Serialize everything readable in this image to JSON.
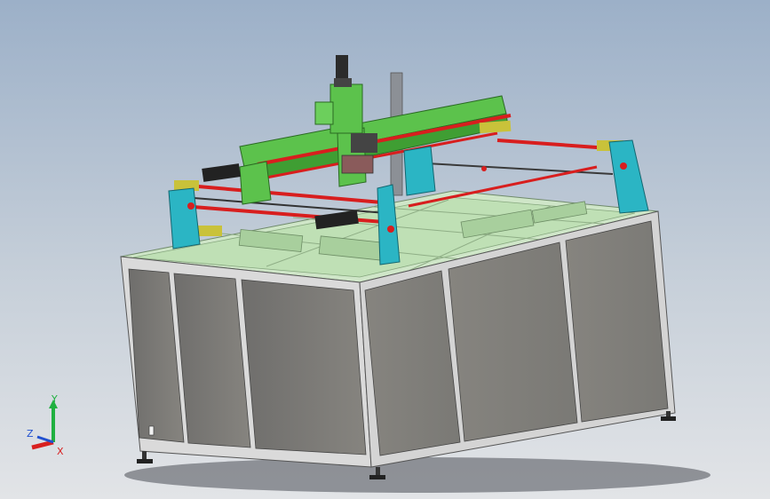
{
  "viewport": {
    "background_top": "#9cb0c8",
    "background_bottom": "#e2e4e7"
  },
  "colors": {
    "frame_green": "#5cc24c",
    "support_cyan": "#2bb5c4",
    "rod_red": "#d81e1e",
    "panel_gray": "#7b7a78",
    "table_top_green": "#cfe6c8"
  },
  "triad": {
    "x_label": "X",
    "y_label": "Y",
    "z_label": "Z",
    "x_color": "#d82020",
    "y_color": "#20b040",
    "z_color": "#2050d0"
  }
}
